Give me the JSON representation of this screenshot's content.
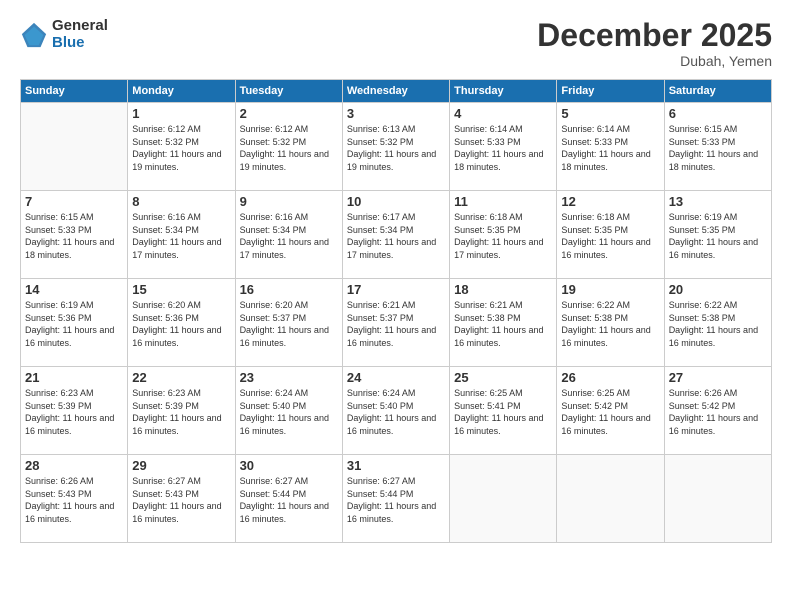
{
  "header": {
    "logo_general": "General",
    "logo_blue": "Blue",
    "month_title": "December 2025",
    "location": "Dubah, Yemen"
  },
  "weekdays": [
    "Sunday",
    "Monday",
    "Tuesday",
    "Wednesday",
    "Thursday",
    "Friday",
    "Saturday"
  ],
  "weeks": [
    [
      {
        "day": null
      },
      {
        "day": 1,
        "sunrise": "6:12 AM",
        "sunset": "5:32 PM",
        "daylight": "11 hours and 19 minutes."
      },
      {
        "day": 2,
        "sunrise": "6:12 AM",
        "sunset": "5:32 PM",
        "daylight": "11 hours and 19 minutes."
      },
      {
        "day": 3,
        "sunrise": "6:13 AM",
        "sunset": "5:32 PM",
        "daylight": "11 hours and 19 minutes."
      },
      {
        "day": 4,
        "sunrise": "6:14 AM",
        "sunset": "5:33 PM",
        "daylight": "11 hours and 18 minutes."
      },
      {
        "day": 5,
        "sunrise": "6:14 AM",
        "sunset": "5:33 PM",
        "daylight": "11 hours and 18 minutes."
      },
      {
        "day": 6,
        "sunrise": "6:15 AM",
        "sunset": "5:33 PM",
        "daylight": "11 hours and 18 minutes."
      }
    ],
    [
      {
        "day": 7,
        "sunrise": "6:15 AM",
        "sunset": "5:33 PM",
        "daylight": "11 hours and 18 minutes."
      },
      {
        "day": 8,
        "sunrise": "6:16 AM",
        "sunset": "5:34 PM",
        "daylight": "11 hours and 17 minutes."
      },
      {
        "day": 9,
        "sunrise": "6:16 AM",
        "sunset": "5:34 PM",
        "daylight": "11 hours and 17 minutes."
      },
      {
        "day": 10,
        "sunrise": "6:17 AM",
        "sunset": "5:34 PM",
        "daylight": "11 hours and 17 minutes."
      },
      {
        "day": 11,
        "sunrise": "6:18 AM",
        "sunset": "5:35 PM",
        "daylight": "11 hours and 17 minutes."
      },
      {
        "day": 12,
        "sunrise": "6:18 AM",
        "sunset": "5:35 PM",
        "daylight": "11 hours and 16 minutes."
      },
      {
        "day": 13,
        "sunrise": "6:19 AM",
        "sunset": "5:35 PM",
        "daylight": "11 hours and 16 minutes."
      }
    ],
    [
      {
        "day": 14,
        "sunrise": "6:19 AM",
        "sunset": "5:36 PM",
        "daylight": "11 hours and 16 minutes."
      },
      {
        "day": 15,
        "sunrise": "6:20 AM",
        "sunset": "5:36 PM",
        "daylight": "11 hours and 16 minutes."
      },
      {
        "day": 16,
        "sunrise": "6:20 AM",
        "sunset": "5:37 PM",
        "daylight": "11 hours and 16 minutes."
      },
      {
        "day": 17,
        "sunrise": "6:21 AM",
        "sunset": "5:37 PM",
        "daylight": "11 hours and 16 minutes."
      },
      {
        "day": 18,
        "sunrise": "6:21 AM",
        "sunset": "5:38 PM",
        "daylight": "11 hours and 16 minutes."
      },
      {
        "day": 19,
        "sunrise": "6:22 AM",
        "sunset": "5:38 PM",
        "daylight": "11 hours and 16 minutes."
      },
      {
        "day": 20,
        "sunrise": "6:22 AM",
        "sunset": "5:38 PM",
        "daylight": "11 hours and 16 minutes."
      }
    ],
    [
      {
        "day": 21,
        "sunrise": "6:23 AM",
        "sunset": "5:39 PM",
        "daylight": "11 hours and 16 minutes."
      },
      {
        "day": 22,
        "sunrise": "6:23 AM",
        "sunset": "5:39 PM",
        "daylight": "11 hours and 16 minutes."
      },
      {
        "day": 23,
        "sunrise": "6:24 AM",
        "sunset": "5:40 PM",
        "daylight": "11 hours and 16 minutes."
      },
      {
        "day": 24,
        "sunrise": "6:24 AM",
        "sunset": "5:40 PM",
        "daylight": "11 hours and 16 minutes."
      },
      {
        "day": 25,
        "sunrise": "6:25 AM",
        "sunset": "5:41 PM",
        "daylight": "11 hours and 16 minutes."
      },
      {
        "day": 26,
        "sunrise": "6:25 AM",
        "sunset": "5:42 PM",
        "daylight": "11 hours and 16 minutes."
      },
      {
        "day": 27,
        "sunrise": "6:26 AM",
        "sunset": "5:42 PM",
        "daylight": "11 hours and 16 minutes."
      }
    ],
    [
      {
        "day": 28,
        "sunrise": "6:26 AM",
        "sunset": "5:43 PM",
        "daylight": "11 hours and 16 minutes."
      },
      {
        "day": 29,
        "sunrise": "6:27 AM",
        "sunset": "5:43 PM",
        "daylight": "11 hours and 16 minutes."
      },
      {
        "day": 30,
        "sunrise": "6:27 AM",
        "sunset": "5:44 PM",
        "daylight": "11 hours and 16 minutes."
      },
      {
        "day": 31,
        "sunrise": "6:27 AM",
        "sunset": "5:44 PM",
        "daylight": "11 hours and 16 minutes."
      },
      {
        "day": null
      },
      {
        "day": null
      },
      {
        "day": null
      }
    ]
  ]
}
